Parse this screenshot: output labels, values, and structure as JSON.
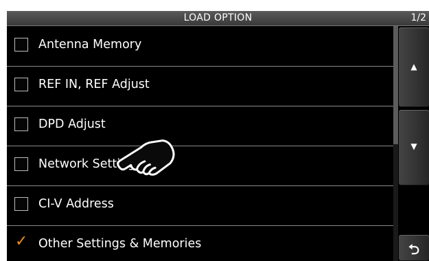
{
  "header": {
    "title": "LOAD OPTION",
    "page": "1/2"
  },
  "options": [
    {
      "label": "Antenna Memory",
      "checked": false
    },
    {
      "label": "REF IN, REF Adjust",
      "checked": false
    },
    {
      "label": "DPD Adjust",
      "checked": false
    },
    {
      "label": "Network Settings",
      "checked": false
    },
    {
      "label": "CI-V Address",
      "checked": false
    },
    {
      "label": "Other Settings & Memories",
      "checked": true
    }
  ],
  "check_glyph": "✓",
  "accent_color": "#f08c1f",
  "scroll": {
    "up_glyph": "▲",
    "down_glyph": "▼",
    "back_glyph": "⮌"
  },
  "icons": [
    "checkbox-icon",
    "check-icon",
    "up-arrow-icon",
    "down-arrow-icon",
    "return-icon",
    "pointing-hand-icon"
  ]
}
